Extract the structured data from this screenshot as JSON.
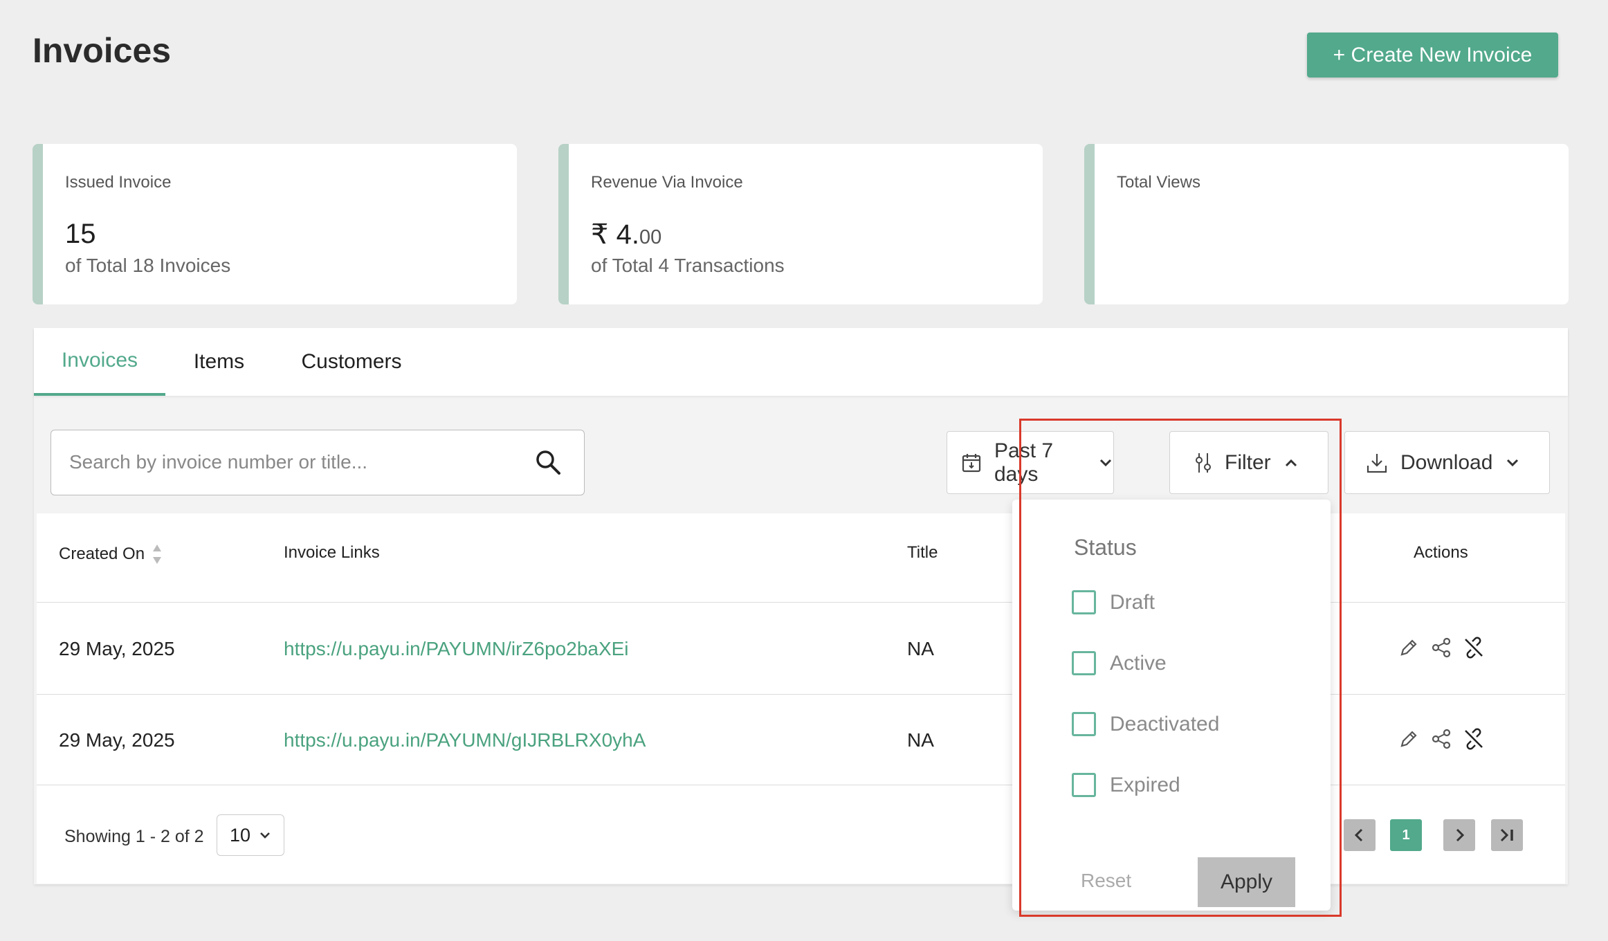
{
  "header": {
    "title": "Invoices",
    "create_button": "+ Create New Invoice"
  },
  "stats": [
    {
      "label": "Issued Invoice",
      "value": "15",
      "sub": "of Total 18 Invoices"
    },
    {
      "label": "Revenue Via Invoice",
      "currency": "₹",
      "value_int": "4.",
      "value_dec": "00",
      "sub": "of Total 4 Transactions"
    },
    {
      "label": "Total Views"
    }
  ],
  "tabs": [
    {
      "label": "Invoices",
      "active": true
    },
    {
      "label": "Items",
      "active": false
    },
    {
      "label": "Customers",
      "active": false
    }
  ],
  "toolbar": {
    "search_placeholder": "Search by invoice number or title...",
    "date_range": "Past 7 days",
    "filter_label": "Filter",
    "download_label": "Download"
  },
  "table": {
    "headers": {
      "created_on": "Created On",
      "links": "Invoice Links",
      "title": "Title",
      "actions": "Actions"
    },
    "rows": [
      {
        "created_on": "29 May, 2025",
        "link": "https://u.payu.in/PAYUMN/irZ6po2baXEi",
        "title": "NA"
      },
      {
        "created_on": "29 May, 2025",
        "link": "https://u.payu.in/PAYUMN/gIJRBLRX0yhA",
        "title": "NA"
      }
    ]
  },
  "footer": {
    "showing": "Showing 1 - 2 of 2",
    "per_page": "10",
    "current_page": "1"
  },
  "filter_dropdown": {
    "title": "Status",
    "options": [
      {
        "label": "Draft",
        "checked": false
      },
      {
        "label": "Active",
        "checked": false
      },
      {
        "label": "Deactivated",
        "checked": false
      },
      {
        "label": "Expired",
        "checked": false
      }
    ],
    "reset": "Reset",
    "apply": "Apply"
  },
  "colors": {
    "accent": "#52a98b",
    "link": "#4aa27f",
    "card_border": "#b7d1c6",
    "highlight": "#d9392b"
  }
}
